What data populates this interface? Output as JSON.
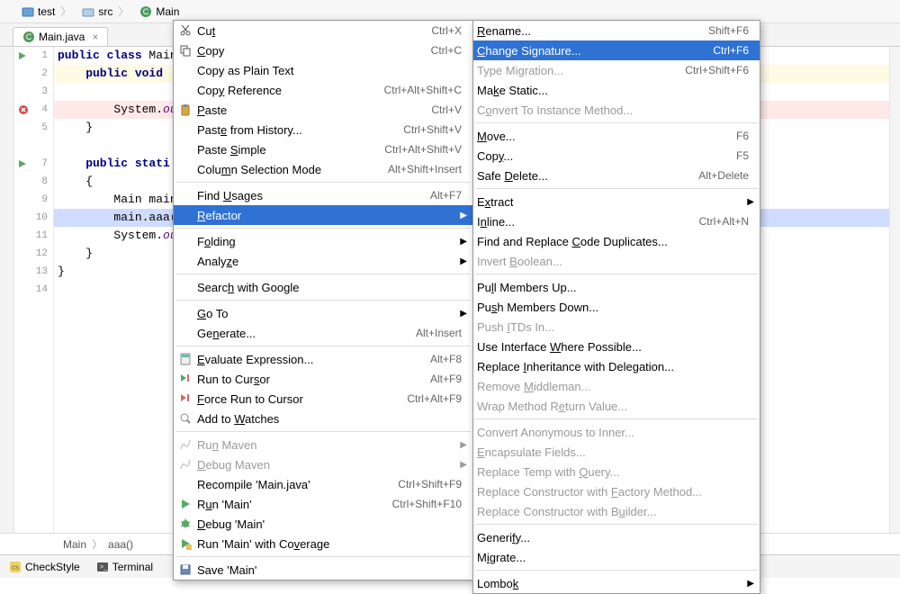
{
  "breadcrumb": [
    {
      "icon": "project",
      "label": "test"
    },
    {
      "icon": "folder",
      "label": "src"
    },
    {
      "icon": "class",
      "label": "Main"
    }
  ],
  "tab": {
    "label": "Main.java",
    "icon": "class"
  },
  "gutter": [
    {
      "n": "1",
      "icon": "run"
    },
    {
      "n": "2",
      "icon": ""
    },
    {
      "n": "3",
      "icon": ""
    },
    {
      "n": "4",
      "icon": "error"
    },
    {
      "n": "5",
      "icon": ""
    },
    {
      "n": "",
      "icon": ""
    },
    {
      "n": "7",
      "icon": "run"
    },
    {
      "n": "8",
      "icon": ""
    },
    {
      "n": "9",
      "icon": ""
    },
    {
      "n": "10",
      "icon": ""
    },
    {
      "n": "11",
      "icon": ""
    },
    {
      "n": "12",
      "icon": ""
    },
    {
      "n": "13",
      "icon": ""
    },
    {
      "n": "14",
      "icon": ""
    }
  ],
  "code": [
    {
      "t": "public class Main",
      "cls": "",
      "kw": "public class "
    },
    {
      "t": "    public void ",
      "cls": "hl-warn",
      "kw": "    public void "
    },
    {
      "t": "",
      "cls": ""
    },
    {
      "t": "        System.ou",
      "cls": "hl-err",
      "field": "ou",
      "pre": "        System."
    },
    {
      "t": "    }",
      "cls": ""
    },
    {
      "t": "",
      "cls": ""
    },
    {
      "t": "    public stati",
      "cls": "",
      "kw": "    public stati"
    },
    {
      "t": "    {",
      "cls": ""
    },
    {
      "t": "        Main main",
      "cls": ""
    },
    {
      "t": "        main.aaa(",
      "cls": "hl-sel"
    },
    {
      "t": "        System.ou",
      "cls": "",
      "field": "ou",
      "pre": "        System."
    },
    {
      "t": "    }",
      "cls": ""
    },
    {
      "t": "}",
      "cls": ""
    },
    {
      "t": "",
      "cls": ""
    }
  ],
  "bc2": {
    "a": "Main",
    "b": "aaa()"
  },
  "bottom": [
    {
      "icon": "cs",
      "label": "CheckStyle"
    },
    {
      "icon": "term",
      "label": "Terminal"
    }
  ],
  "menu1": [
    {
      "icon": "cut",
      "label": "Cu",
      "u": "t",
      "rest": "",
      "short": "Ctrl+X"
    },
    {
      "icon": "copy",
      "label": "",
      "u": "C",
      "rest": "opy",
      "short": "Ctrl+C"
    },
    {
      "icon": "",
      "label": "Copy as Plain Text",
      "short": ""
    },
    {
      "icon": "",
      "label": "Cop",
      "u": "y",
      "rest": " Reference",
      "short": "Ctrl+Alt+Shift+C"
    },
    {
      "icon": "paste",
      "label": "",
      "u": "P",
      "rest": "aste",
      "short": "Ctrl+V"
    },
    {
      "icon": "",
      "label": "Past",
      "u": "e",
      "rest": " from History...",
      "short": "Ctrl+Shift+V"
    },
    {
      "icon": "",
      "label": "Paste ",
      "u": "S",
      "rest": "imple",
      "short": "Ctrl+Alt+Shift+V"
    },
    {
      "icon": "",
      "label": "Colu",
      "u": "m",
      "rest": "n Selection Mode",
      "short": "Alt+Shift+Insert"
    },
    {
      "sep": true
    },
    {
      "icon": "",
      "label": "Find ",
      "u": "U",
      "rest": "sages",
      "short": "Alt+F7"
    },
    {
      "icon": "",
      "label": "",
      "u": "R",
      "rest": "efactor",
      "short": "",
      "sub": true,
      "hl": true
    },
    {
      "sep": true
    },
    {
      "icon": "",
      "label": "F",
      "u": "o",
      "rest": "lding",
      "short": "",
      "sub": true
    },
    {
      "icon": "",
      "label": "Analy",
      "u": "z",
      "rest": "e",
      "short": "",
      "sub": true
    },
    {
      "sep": true
    },
    {
      "icon": "",
      "label": "Searc",
      "u": "h",
      "rest": " with Google",
      "short": ""
    },
    {
      "sep": true
    },
    {
      "icon": "",
      "label": "",
      "u": "G",
      "rest": "o To",
      "short": "",
      "sub": true
    },
    {
      "icon": "",
      "label": "Ge",
      "u": "n",
      "rest": "erate...",
      "short": "Alt+Insert"
    },
    {
      "sep": true
    },
    {
      "icon": "calc",
      "label": "",
      "u": "E",
      "rest": "valuate Expression...",
      "short": "Alt+F8"
    },
    {
      "icon": "runto",
      "label": "Run to Cur",
      "u": "s",
      "rest": "or",
      "short": "Alt+F9"
    },
    {
      "icon": "forceto",
      "label": "",
      "u": "F",
      "rest": "orce Run to Cursor",
      "short": "Ctrl+Alt+F9"
    },
    {
      "icon": "watch",
      "label": "Add to ",
      "u": "W",
      "rest": "atches",
      "short": ""
    },
    {
      "sep": true
    },
    {
      "icon": "maven",
      "label": "Ru",
      "u": "n",
      "rest": " Maven",
      "short": "",
      "sub": true,
      "dis": true
    },
    {
      "icon": "maven",
      "label": "",
      "u": "D",
      "rest": "ebug Maven",
      "short": "",
      "sub": true,
      "dis": true
    },
    {
      "icon": "",
      "label": "Recompile 'Main.",
      "u": "j",
      "rest": "ava'",
      "short": "Ctrl+Shift+F9"
    },
    {
      "icon": "run",
      "label": "R",
      "u": "u",
      "rest": "n 'Main'",
      "short": "Ctrl+Shift+F10"
    },
    {
      "icon": "debug",
      "label": "",
      "u": "D",
      "rest": "ebug 'Main'",
      "short": ""
    },
    {
      "icon": "cover",
      "label": "Run 'Main' with Co",
      "u": "v",
      "rest": "erage",
      "short": ""
    },
    {
      "sep": true
    },
    {
      "icon": "save",
      "label": "Save 'Main'",
      "short": ""
    }
  ],
  "menu2": [
    {
      "label": "",
      "u": "R",
      "rest": "ename...",
      "short": "Shift+F6"
    },
    {
      "label": "",
      "u": "C",
      "rest": "hange Signature...",
      "short": "Ctrl+F6",
      "hl": true
    },
    {
      "label": "Type Mi",
      "u": "g",
      "rest": "ration...",
      "short": "Ctrl+Shift+F6",
      "dis": true
    },
    {
      "label": "Ma",
      "u": "k",
      "rest": "e Static...",
      "short": ""
    },
    {
      "label": "C",
      "u": "o",
      "rest": "nvert To Instance Method...",
      "short": "",
      "dis": true
    },
    {
      "sep": true
    },
    {
      "label": "",
      "u": "M",
      "rest": "ove...",
      "short": "F6"
    },
    {
      "label": "Cop",
      "u": "y",
      "rest": "...",
      "short": "F5"
    },
    {
      "label": "Safe ",
      "u": "D",
      "rest": "elete...",
      "short": "Alt+Delete"
    },
    {
      "sep": true
    },
    {
      "label": "E",
      "u": "x",
      "rest": "tract",
      "short": "",
      "sub": true
    },
    {
      "label": "I",
      "u": "n",
      "rest": "line...",
      "short": "Ctrl+Alt+N"
    },
    {
      "label": "Find and Replace ",
      "u": "C",
      "rest": "ode Duplicates...",
      "short": ""
    },
    {
      "label": "Invert ",
      "u": "B",
      "rest": "oolean...",
      "short": "",
      "dis": true
    },
    {
      "sep": true
    },
    {
      "label": "Pu",
      "u": "l",
      "rest": "l Members Up...",
      "short": ""
    },
    {
      "label": "Pu",
      "u": "s",
      "rest": "h Members Down...",
      "short": ""
    },
    {
      "label": "Push ",
      "u": "I",
      "rest": "TDs In...",
      "short": "",
      "dis": true
    },
    {
      "label": "Use Interface ",
      "u": "W",
      "rest": "here Possible...",
      "short": ""
    },
    {
      "label": "Replace ",
      "u": "I",
      "rest": "nheritance with Delegation...",
      "short": ""
    },
    {
      "label": "Remove ",
      "u": "M",
      "rest": "iddleman...",
      "short": "",
      "dis": true
    },
    {
      "label": "Wrap Method R",
      "u": "e",
      "rest": "turn Value...",
      "short": "",
      "dis": true
    },
    {
      "sep": true
    },
    {
      "label": "Convert Anonymous to Inner...",
      "short": "",
      "dis": true
    },
    {
      "label": "",
      "u": "E",
      "rest": "ncapsulate Fields...",
      "short": "",
      "dis": true
    },
    {
      "label": "Replace Temp with ",
      "u": "Q",
      "rest": "uery...",
      "short": "",
      "dis": true
    },
    {
      "label": "Replace Constructor with ",
      "u": "F",
      "rest": "actory Method...",
      "short": "",
      "dis": true
    },
    {
      "label": "Replace Constructor with B",
      "u": "u",
      "rest": "ilder...",
      "short": "",
      "dis": true
    },
    {
      "sep": true
    },
    {
      "label": "Generi",
      "u": "f",
      "rest": "y...",
      "short": ""
    },
    {
      "label": "M",
      "u": "i",
      "rest": "grate...",
      "short": ""
    },
    {
      "sep": true
    },
    {
      "label": "Lombo",
      "u": "k",
      "rest": "",
      "short": "",
      "sub": true
    }
  ]
}
